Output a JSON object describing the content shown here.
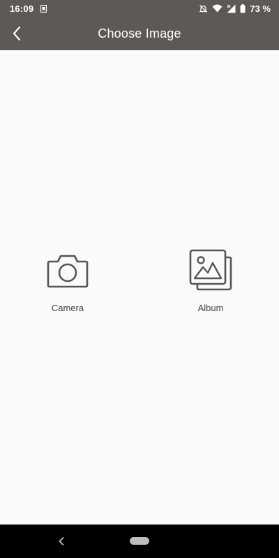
{
  "status_bar": {
    "time": "16:09",
    "battery_percent": "73 %",
    "icons": [
      "sim-card-icon",
      "mute-icon",
      "wifi-icon",
      "cell-signal-icon",
      "battery-icon"
    ]
  },
  "app_bar": {
    "title": "Choose Image",
    "back_icon": "chevron-left-icon"
  },
  "options": [
    {
      "label": "Camera",
      "icon": "camera-icon"
    },
    {
      "label": "Album",
      "icon": "album-icon"
    }
  ],
  "nav_bar": {
    "back_icon": "nav-back-icon",
    "home_icon": "home-pill-icon"
  },
  "colors": {
    "header_bg": "#5e5955",
    "content_bg": "#fafafa",
    "icon_stroke": "#555555",
    "label_text": "#444444",
    "nav_bg": "#000000"
  }
}
